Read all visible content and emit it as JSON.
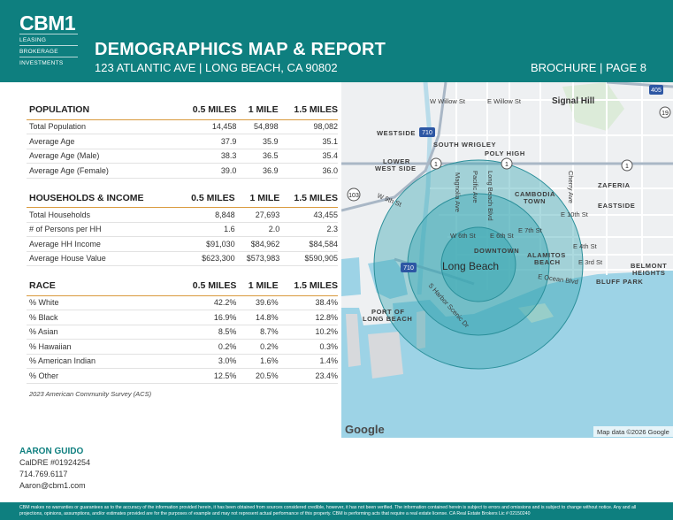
{
  "header": {
    "logo": "CBM1",
    "logo_lines": [
      "LEASING",
      "BROKERAGE",
      "INVESTMENTS"
    ],
    "title": "DEMOGRAPHICS MAP & REPORT",
    "address": "123 ATLANTIC AVE | LONG BEACH, CA 90802",
    "page_ref": "BROCHURE | PAGE 8"
  },
  "population": {
    "heading": "POPULATION",
    "columns": [
      "0.5 MILES",
      "1 MILE",
      "1.5 MILES"
    ],
    "rows": [
      {
        "label": "Total Population",
        "values": [
          "14,458",
          "54,898",
          "98,082"
        ]
      },
      {
        "label": "Average Age",
        "values": [
          "37.9",
          "35.9",
          "35.1"
        ]
      },
      {
        "label": "Average Age (Male)",
        "values": [
          "38.3",
          "36.5",
          "35.4"
        ]
      },
      {
        "label": "Average Age (Female)",
        "values": [
          "39.0",
          "36.9",
          "36.0"
        ]
      }
    ]
  },
  "households": {
    "heading": "HOUSEHOLDS & INCOME",
    "columns": [
      "0.5 MILES",
      "1 MILE",
      "1.5 MILES"
    ],
    "rows": [
      {
        "label": "Total Households",
        "values": [
          "8,848",
          "27,693",
          "43,455"
        ]
      },
      {
        "label": "# of Persons per HH",
        "values": [
          "1.6",
          "2.0",
          "2.3"
        ]
      },
      {
        "label": "Average HH Income",
        "values": [
          "$91,030",
          "$84,962",
          "$84,584"
        ]
      },
      {
        "label": "Average House Value",
        "values": [
          "$623,300",
          "$573,983",
          "$590,905"
        ]
      }
    ]
  },
  "race": {
    "heading": "RACE",
    "columns": [
      "0.5 MILES",
      "1 MILE",
      "1.5 MILES"
    ],
    "rows": [
      {
        "label": "% White",
        "values": [
          "42.2%",
          "39.6%",
          "38.4%"
        ]
      },
      {
        "label": "% Black",
        "values": [
          "16.9%",
          "14.8%",
          "12.8%"
        ]
      },
      {
        "label": "% Asian",
        "values": [
          "8.5%",
          "8.7%",
          "10.2%"
        ]
      },
      {
        "label": "% Hawaiian",
        "values": [
          "0.2%",
          "0.2%",
          "0.3%"
        ]
      },
      {
        "label": "% American Indian",
        "values": [
          "3.0%",
          "1.6%",
          "1.4%"
        ]
      },
      {
        "label": "% Other",
        "values": [
          "12.5%",
          "20.5%",
          "23.4%"
        ]
      }
    ]
  },
  "source": "2023 American Community Survey (ACS)",
  "map": {
    "labels": {
      "w_willow": "W Willow St",
      "e_willow": "E Willow St",
      "signal_hill": "Signal Hill",
      "westside": "WESTSIDE",
      "south_wrigley": "SOUTH WRIGLEY",
      "poly_high": "POLY HIGH",
      "lower_west_side_1": "LOWER",
      "lower_west_side_2": "WEST SIDE",
      "zaferia": "ZAFERIA",
      "cambodia_1": "CAMBODIA",
      "cambodia_2": "TOWN",
      "eastside": "EASTSIDE",
      "w9th": "W 9th St",
      "e10th": "E 10th St",
      "w6th": "W 6th St",
      "e6th": "E 6th St",
      "e7th": "E 7th St",
      "e4th": "E 4th St",
      "e3rd": "E 3rd St",
      "downtown": "DOWNTOWN",
      "long_beach": "Long Beach",
      "alamitos_1": "ALAMITOS",
      "alamitos_2": "BEACH",
      "belmont_1": "BELMONT",
      "belmont_2": "HEIGHTS",
      "bluff_park": "BLUFF PARK",
      "e_ocean": "E Ocean Blvd",
      "port_1": "PORT OF",
      "port_2": "LONG BEACH",
      "harbor": "S Harbor Scenic Dr",
      "magnolia": "Magnolia Ave",
      "pacific": "Pacific Ave",
      "long_beach_blvd": "Long Beach Blvd",
      "cherry": "Cherry Ave",
      "google": "Google",
      "attribution": "Map data ©2026 Google"
    },
    "shields": [
      "405",
      "19",
      "710",
      "1",
      "1",
      "1",
      "103",
      "710"
    ]
  },
  "contact": {
    "name": "AARON GUIDO",
    "license": "CalDRE #01924254",
    "phone": "714.769.6117",
    "email": "Aaron@cbm1.com"
  },
  "disclaimer": "CBM makes no warranties or guarantees as to the accuracy of the information provided herein, it has been obtained from sources considered credible, however, it has not been verified. The information contained herein is subject to errors and omissions and is subject to change without notice. Any and all projections, opinions, assumptions, and/or estimates provided are for the purposes of example and may not represent actual performance of this property. CBM is performing acts that require a real estate license. CA Real Estate Brokers Lic # 02150240",
  "colors": {
    "brand": "#0e7f7f",
    "accent_rule": "#d99a3d",
    "radius_fill": "#3aa7b3",
    "water": "#9dd3e6"
  }
}
